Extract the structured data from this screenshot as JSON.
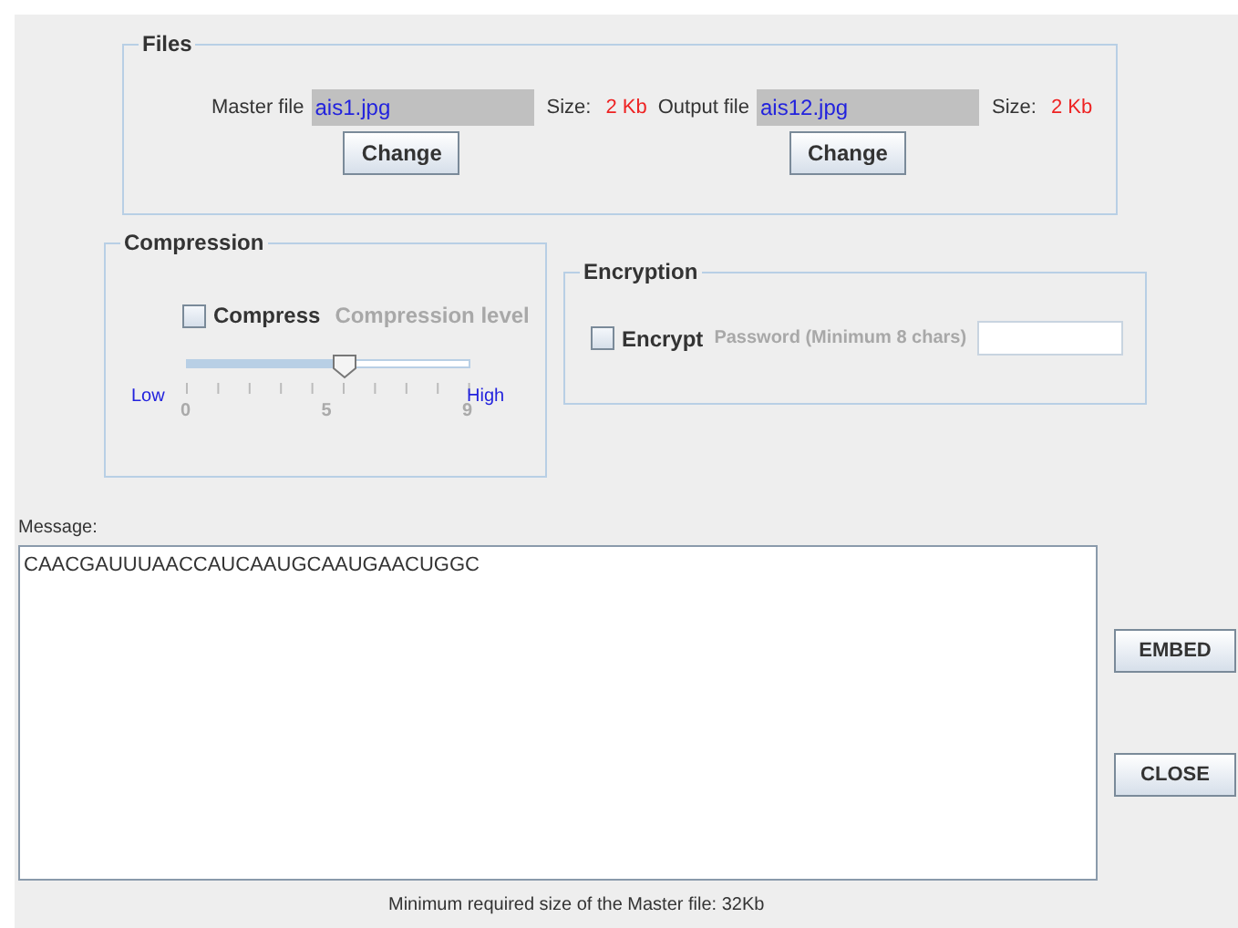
{
  "files": {
    "title": "Files",
    "master": {
      "label": "Master file",
      "value": "ais1.jpg",
      "size_label": "Size:",
      "size": "2 Kb",
      "button": "Change"
    },
    "output": {
      "label": "Output file",
      "value": "ais12.jpg",
      "size_label": "Size:",
      "size": "2 Kb",
      "button": "Change"
    }
  },
  "compression": {
    "title": "Compression",
    "checkbox": {
      "label": "Compress",
      "checked": false
    },
    "level_label": {
      "text": "Compression level",
      "disabled": true
    },
    "slider": {
      "level": 0.556,
      "low": "Low",
      "high": "High",
      "ticks": [
        "0",
        "5",
        "9"
      ]
    }
  },
  "encryption": {
    "title": "Encryption",
    "checkbox": {
      "label": "Encrypt",
      "checked": false
    },
    "password_label": {
      "text": "Password (Minimum 8 chars)",
      "disabled": true
    }
  },
  "message": {
    "label": "Message:",
    "value": "CAACGAUUUAACCAUCAAUGCAAUGAACUGGC"
  },
  "buttons": [
    "EMBED",
    "CLOSE"
  ],
  "status": "Minimum required size of the Master file: 32Kb"
}
